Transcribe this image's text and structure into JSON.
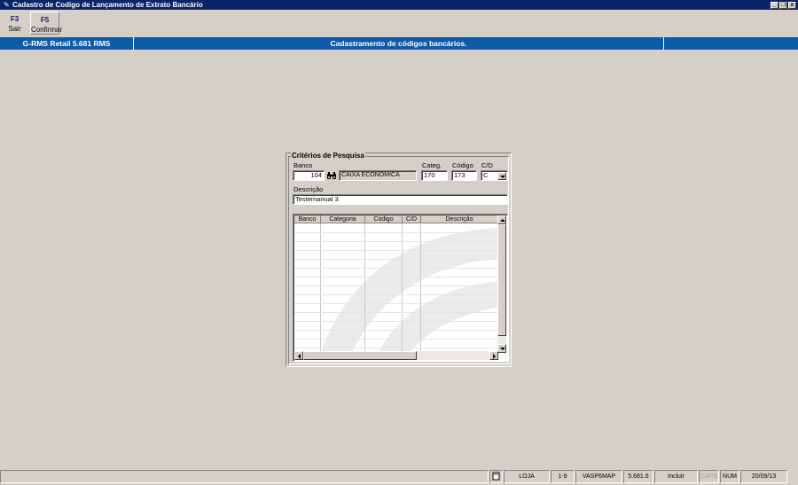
{
  "window": {
    "title": "Cadastro de Codigo de Lançamento de Extrato Bancário",
    "controls": {
      "minimize": "_",
      "restore": "❐",
      "close": "x"
    }
  },
  "toolbar": {
    "buttons": [
      {
        "key": "F3",
        "label": "Sair"
      },
      {
        "key": "F5",
        "label": "Confirmar"
      }
    ]
  },
  "header_bar": {
    "left": "G-RMS Retail 5.681 RMS",
    "center": "Cadastramento de códigos bancários."
  },
  "search": {
    "group_title": "Critérios de Pesquisa",
    "banco": {
      "label": "Banco",
      "value": "104",
      "name": "CAIXA ECONOMICA FEDERAL"
    },
    "categ": {
      "label": "Categ.",
      "value": "170"
    },
    "codigo": {
      "label": "Código",
      "value": "173"
    },
    "cd": {
      "label": "C/D",
      "value": "C"
    },
    "descricao": {
      "label": "Descrição",
      "value": "Testemanual 3"
    }
  },
  "grid": {
    "columns": [
      "Banco",
      "Categoria",
      "Código",
      "C/D",
      "Descrição"
    ],
    "rows": []
  },
  "statusbar": {
    "panels": [
      "LOJA",
      "1-9",
      "VASP6MAP",
      "5.681.6",
      "Incluir",
      "CAPS",
      "NUM",
      "20/09/13"
    ]
  },
  "colors": {
    "titlebar": "#0a246a",
    "header_bar": "#0d5ba9",
    "background": "#d4d0c8"
  },
  "icons": {
    "app": "app-icon",
    "lookup": "binoculars-icon",
    "status_doc": "document-icon"
  }
}
